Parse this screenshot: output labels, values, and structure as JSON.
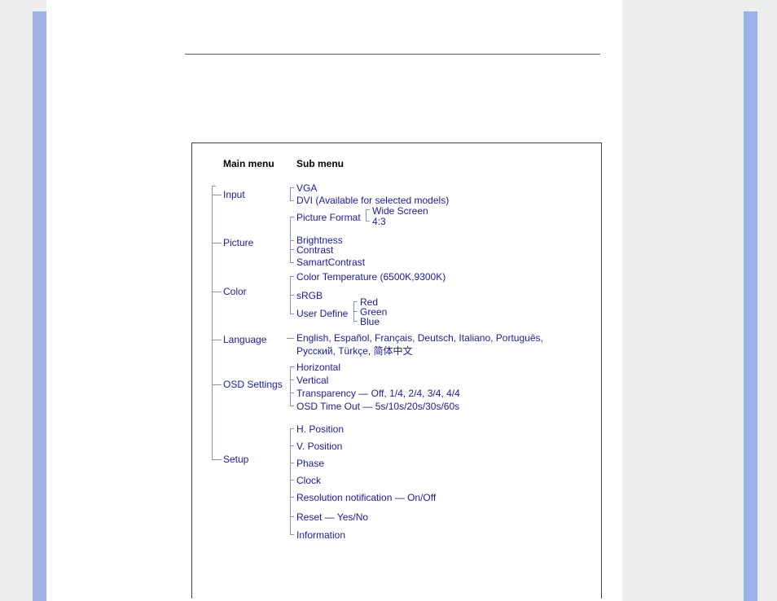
{
  "headings": {
    "main": "Main menu",
    "sub": "Sub menu"
  },
  "menu": {
    "input": {
      "label": "Input",
      "items": {
        "vga": "VGA",
        "dvi": "DVI (Available for selected models)"
      }
    },
    "picture": {
      "label": "Picture",
      "items": {
        "picture_format": "Picture Format",
        "picture_format_opts": {
          "wide": "Wide Screen",
          "ratio43": "4:3"
        },
        "brightness": "Brightness",
        "contrast": "Contrast",
        "smart_contrast": "SamartContrast"
      }
    },
    "color": {
      "label": "Color",
      "items": {
        "color_temp": "Color Temperature (6500K,9300K)",
        "srgb": "sRGB",
        "user_define": "User Define",
        "user_define_opts": {
          "red": "Red",
          "green": "Green",
          "blue": "Blue"
        }
      }
    },
    "language": {
      "label": "Language",
      "items": {
        "line1": "English, Español, Français, Deutsch, Italiano, Português,",
        "line2": "Русский, Türkçe, 简体中文"
      }
    },
    "osd": {
      "label": "OSD Settings",
      "items": {
        "horizontal": "Horizontal",
        "vertical": "Vertical",
        "transparency": "Transparency",
        "transparency_opts": "Off, 1/4, 2/4, 3/4, 4/4",
        "timeout": "OSD Time Out",
        "timeout_opts": "5s/10s/20s/30s/60s"
      }
    },
    "setup": {
      "label": "Setup",
      "items": {
        "hpos": "H. Position",
        "vpos": "V. Position",
        "phase": "Phase",
        "clock": "Clock",
        "res_notify": "Resolution notification",
        "res_notify_opts": "On/Off",
        "reset": "Reset",
        "reset_opts": "Yes/No",
        "information": "Information"
      }
    }
  }
}
